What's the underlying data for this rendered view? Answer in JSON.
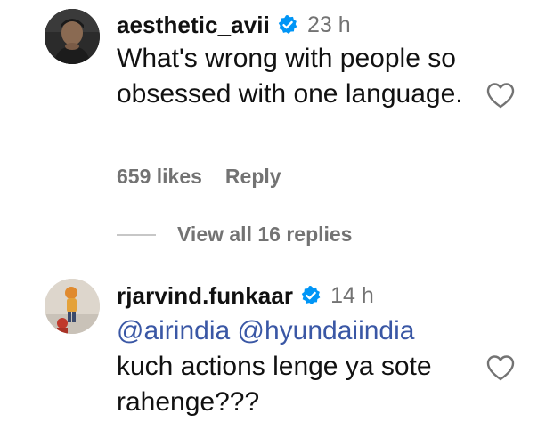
{
  "comments": [
    {
      "username": "aesthetic_avii",
      "time": "23 h",
      "text": "What's wrong with people so obsessed with one language.",
      "likes": "659 likes",
      "reply": "Reply",
      "view_replies": "View all 16 replies"
    },
    {
      "username": "rjarvind.funkaar",
      "time": "14 h",
      "mentions": [
        "@airindia",
        "@hyundaiindia"
      ],
      "text_line1": "kuch actions lenge ya sote",
      "text_line2": "rahenge???"
    }
  ],
  "colors": {
    "verified": "#0095f6",
    "mention": "#3a57a5",
    "secondary_text": "#737373"
  },
  "icons": {
    "verified": "verified-badge-icon",
    "like": "heart-outline-icon"
  }
}
